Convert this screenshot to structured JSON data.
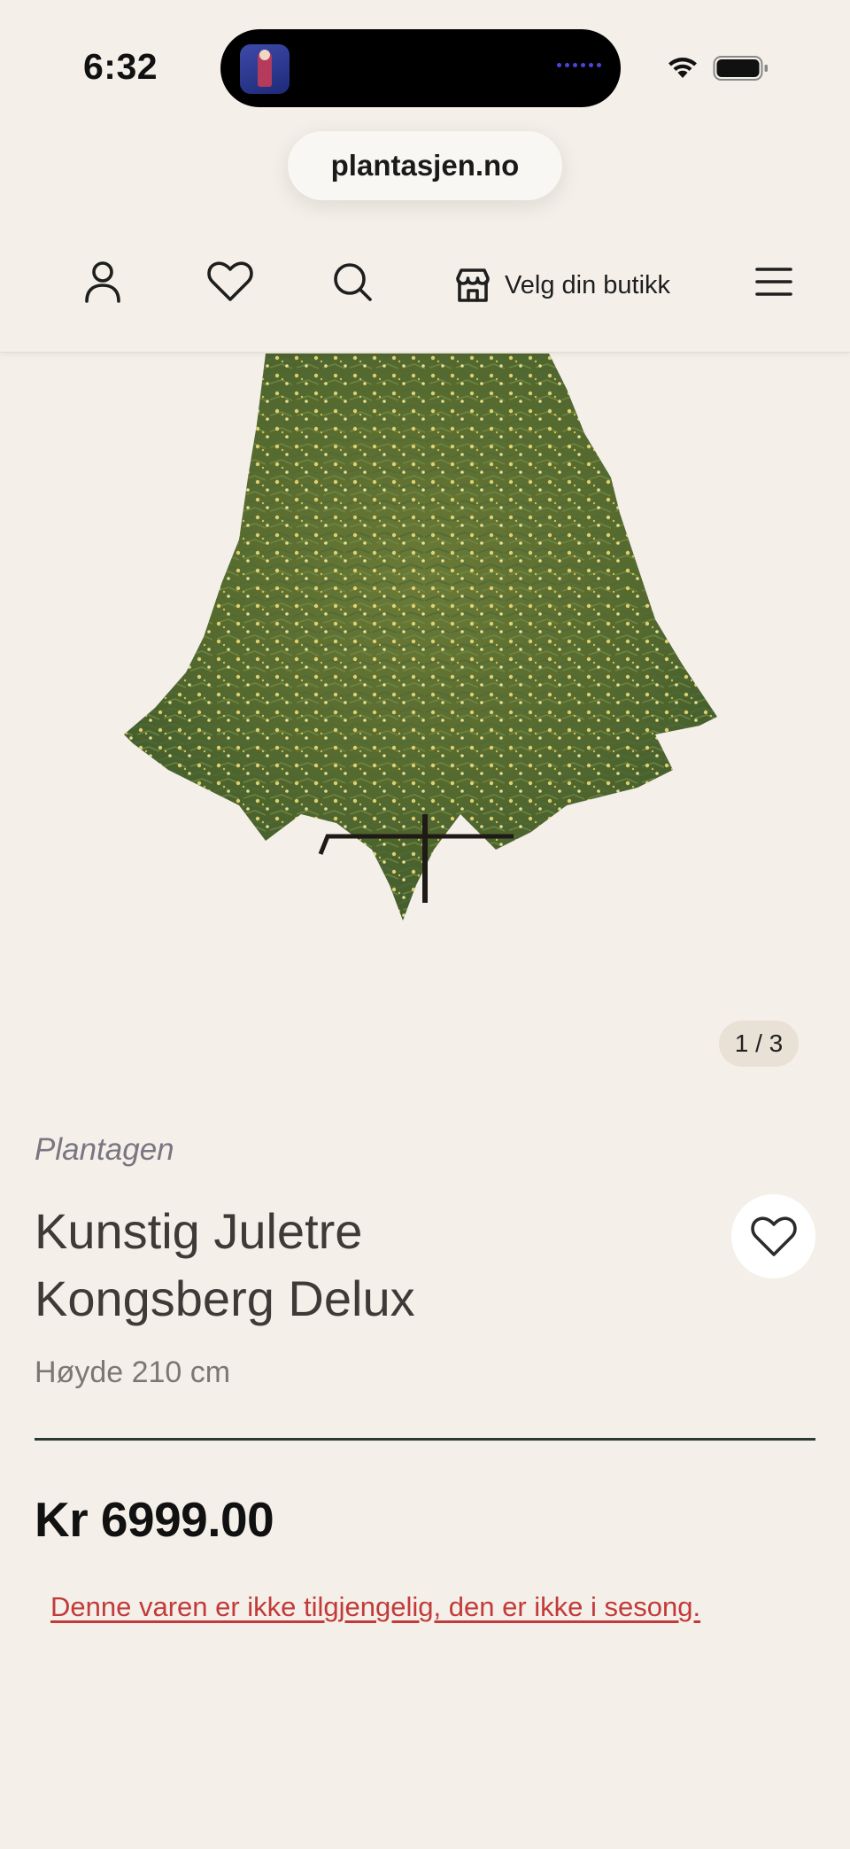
{
  "status_bar": {
    "time": "6:32"
  },
  "browser": {
    "url": "plantasjen.no"
  },
  "header": {
    "store_label": "Velg din butikk",
    "icons": [
      "account-icon",
      "heart-icon",
      "search-icon",
      "store-icon",
      "menu-icon"
    ]
  },
  "gallery": {
    "counter": "1 / 3"
  },
  "product": {
    "brand": "Plantagen",
    "title": "Kunstig Juletre Kongsberg Delux",
    "height": "Høyde 210 cm",
    "price": "Kr 6999.00",
    "availability": "Denne varen er ikke tilgjengelig, den er ikke i sesong."
  },
  "colors": {
    "background": "#f4f0e9",
    "text": "#3e3a37",
    "brand_text": "#7a7682",
    "error": "#c23a3a",
    "divider": "#2c3a34"
  }
}
